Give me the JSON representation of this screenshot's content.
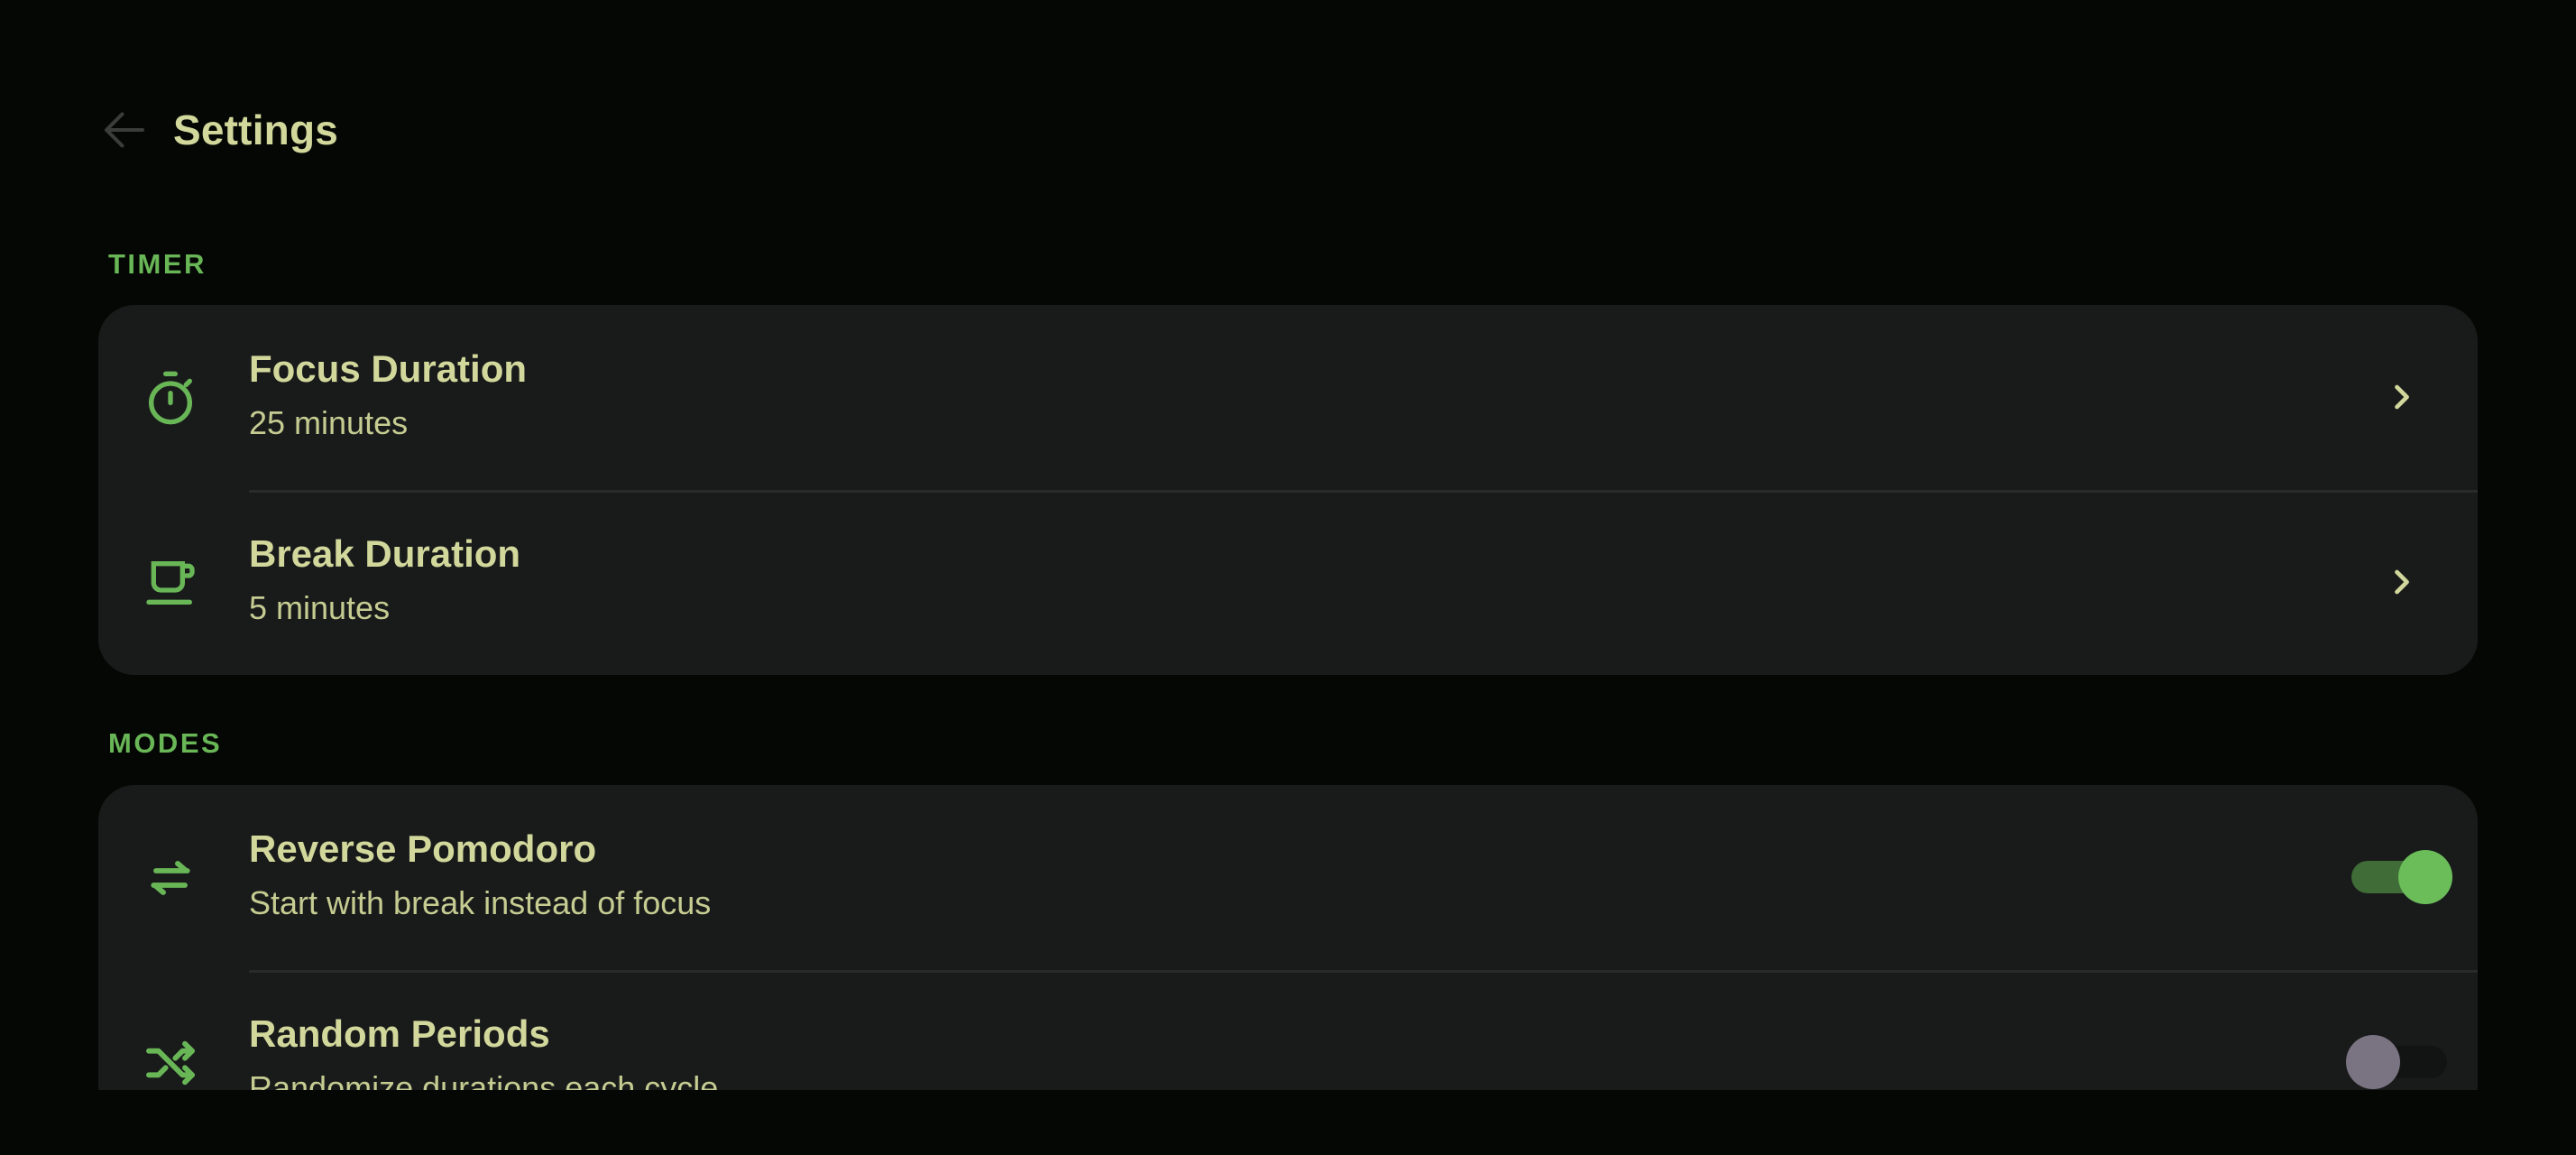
{
  "header": {
    "back_icon": "arrow-back-icon",
    "title": "Settings"
  },
  "colors": {
    "background": "#040704",
    "card": "#191b1b",
    "accent": "#69b657",
    "title_text": "#d2d79b"
  },
  "sections": [
    {
      "label": "TIMER",
      "items": [
        {
          "icon": "timer-icon",
          "title": "Focus Duration",
          "subtitle": "25 minutes",
          "control": "chevron-right-icon"
        },
        {
          "icon": "coffee-cup-icon",
          "title": "Break Duration",
          "subtitle": "5 minutes",
          "control": "chevron-right-icon"
        }
      ]
    },
    {
      "label": "MODES",
      "items": [
        {
          "icon": "swap-arrows-icon",
          "title": "Reverse Pomodoro",
          "subtitle": "Start with break instead of focus",
          "toggle_on": true
        },
        {
          "icon": "shuffle-icon",
          "title": "Random Periods",
          "subtitle": "Randomize durations each cycle",
          "toggle_on": false
        }
      ]
    }
  ]
}
